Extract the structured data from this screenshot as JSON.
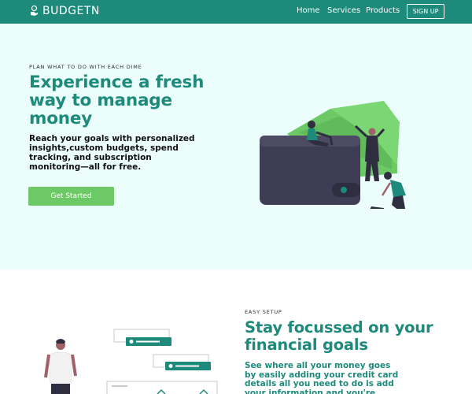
{
  "navbar": {
    "brand": "BUDGETN",
    "brand_icon": "hand-coin-icon",
    "links": [
      "Home",
      "Services",
      "Products"
    ],
    "signup_label": "SIGN UP"
  },
  "hero": {
    "eyebrow": "PLAN WHAT TO DO WITH EACH DIME",
    "title": "Experience a fresh way to manage money",
    "description": "Reach your goals with personalized insights,custom budgets, spend tracking, and subscription monitoring—all for free.",
    "cta_label": "Get Started"
  },
  "section2": {
    "eyebrow": "EASY SETUP",
    "title": "Stay focussed on your financial goals",
    "description": "See where all your money goes by easily adding your credit card details all you need to do is add your information and you're ready"
  },
  "colors": {
    "primary": "#1e8a7b",
    "hero_bg": "#ebfefb",
    "cta": "#6cc965",
    "wallet": "#3f3d56",
    "money": "#6cc965"
  }
}
